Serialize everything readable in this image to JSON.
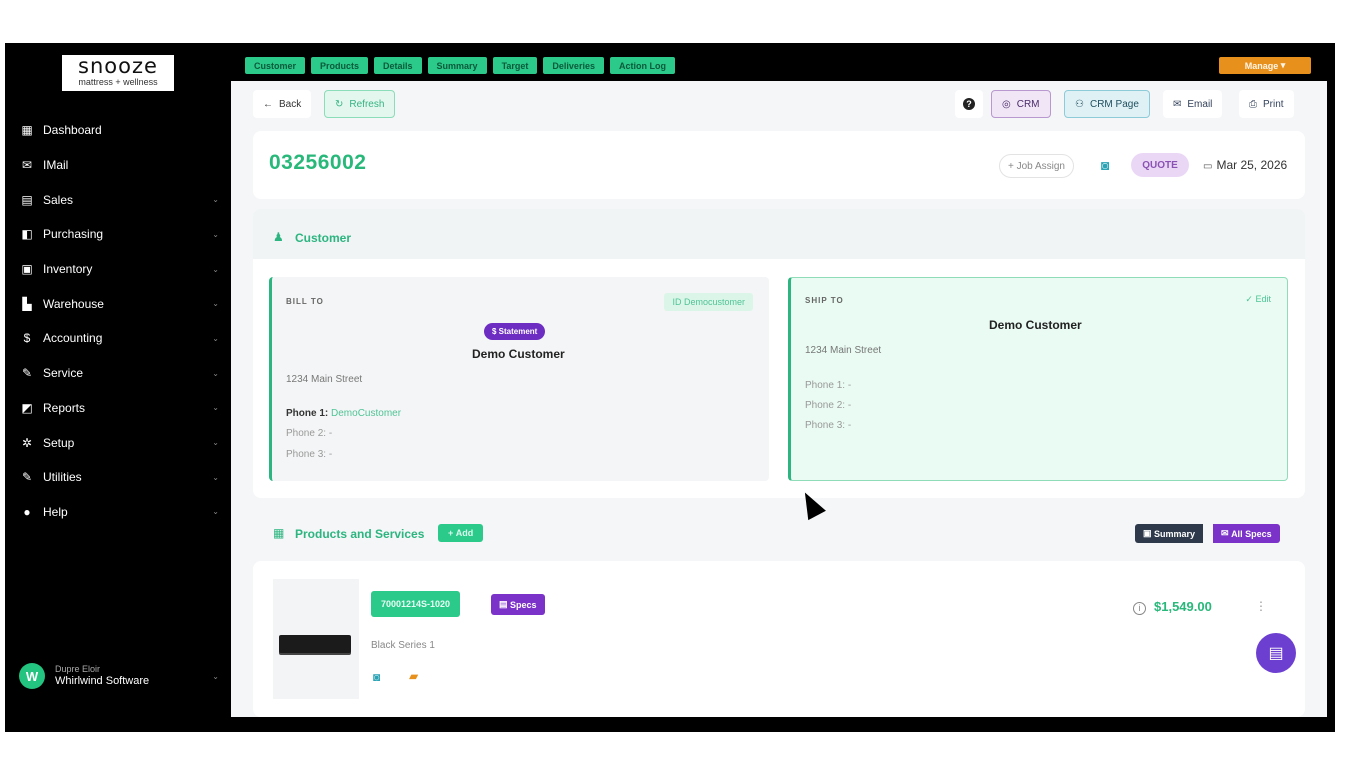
{
  "logo": {
    "brand": "snooze",
    "tagline": "mattress + wellness"
  },
  "sidebar": {
    "items": [
      {
        "label": "Dashboard",
        "icon": "▦"
      },
      {
        "label": "IMail",
        "icon": "✉"
      },
      {
        "label": "Sales",
        "icon": "▤"
      },
      {
        "label": "Purchasing",
        "icon": "◧"
      },
      {
        "label": "Inventory",
        "icon": "▣"
      },
      {
        "label": "Warehouse",
        "icon": "▙"
      },
      {
        "label": "Accounting",
        "icon": "$"
      },
      {
        "label": "Service",
        "icon": "✎"
      },
      {
        "label": "Reports",
        "icon": "◩"
      },
      {
        "label": "Setup",
        "icon": "✲"
      },
      {
        "label": "Utilities",
        "icon": "✎"
      },
      {
        "label": "Help",
        "icon": "●"
      }
    ]
  },
  "user": {
    "initial": "W",
    "role": "Dupre Eloir",
    "company": "Whirlwind Software"
  },
  "topbar": {
    "tabs": [
      "Customer",
      "Products",
      "Details",
      "Summary",
      "Target",
      "Deliveries",
      "Action Log"
    ],
    "manage": "Manage"
  },
  "toolbar": {
    "back": "Back",
    "refresh": "Refresh",
    "crm": "CRM",
    "crm_page": "CRM Page",
    "email": "Email",
    "print": "Print"
  },
  "header": {
    "order_number": "03256002",
    "job_assign": "Job Assign",
    "status": "QUOTE",
    "date": "Mar 25, 2026"
  },
  "customer": {
    "section_title": "Customer",
    "bill_to": {
      "label": "BILL TO",
      "badge": "ID Democustomer",
      "statement": "$ Statement",
      "name": "Demo Customer",
      "address": "1234 Main Street",
      "phone1_label": "Phone 1:",
      "phone1_value": "DemoCustomer",
      "phone2": "Phone 2: -",
      "phone3": "Phone 3: -"
    },
    "ship_to": {
      "label": "SHIP TO",
      "edit": "Edit",
      "name": "Demo Customer",
      "address": "1234 Main Street",
      "phone1": "Phone 1: -",
      "phone2": "Phone 2: -",
      "phone3": "Phone 3: -"
    }
  },
  "products": {
    "section_title": "Products and Services",
    "add": "Add",
    "summary": "Summary",
    "all_specs": "All Specs",
    "items": [
      {
        "sku": "70001214S-1020",
        "specs": "Specs",
        "description": "Black Series 1",
        "price": "$1,549.00"
      }
    ]
  },
  "colors": {
    "accent": "#2cb580",
    "purple": "#7a32c8",
    "manage": "#e8901c"
  }
}
